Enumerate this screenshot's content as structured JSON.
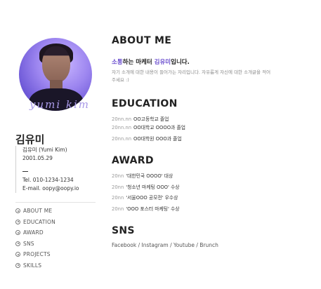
{
  "profile": {
    "signature": "yumi kim",
    "name": "김유미",
    "info": [
      "김유미 (Yumi Kim)",
      "2001.05.29"
    ],
    "contact": [
      "Tel. 010-1234-1234",
      "E-mail. oopy@oopy.io"
    ]
  },
  "nav": [
    "ABOUT ME",
    "EDUCATION",
    "AWARD",
    "SNS",
    "PROJECTS",
    "SKILLS"
  ],
  "about": {
    "title": "ABOUT ME",
    "headline_accent1": "소통",
    "headline_mid": "하는 마케터 ",
    "headline_accent2": "김유미",
    "headline_end": "입니다.",
    "text_line1": "자기 소개에 대한 내용이 들어가는 자리입니다. 자유롭게 자신에 대한 소개글을 적어",
    "text_line2": "주세요 :)"
  },
  "education": {
    "title": "EDUCATION",
    "items": [
      {
        "year": "20nn.nn",
        "text": "OO고등학교 졸업"
      },
      {
        "year": "20nn.nn",
        "text": "OO대학교 OOOO과 졸업"
      },
      {
        "year": "20nn.nn",
        "text": "OO대학원 OOO과 졸업"
      }
    ]
  },
  "award": {
    "title": "AWARD",
    "items": [
      {
        "year": "20nn",
        "text": "'대한민국 OOOO' 대상"
      },
      {
        "year": "20nn",
        "text": "'청소년 마케팅 OOO' 수상"
      },
      {
        "year": "20nn",
        "text": "'서울OOO 공모전' 우수상"
      },
      {
        "year": "20nn",
        "text": "'OOO 포스터 마케팅' 수상"
      }
    ]
  },
  "sns": {
    "title": "SNS",
    "links": [
      "Facebook",
      "Instagram",
      "Youtube",
      "Brunch"
    ],
    "separator": " / "
  },
  "colors": {
    "accent": "#6b4fcf",
    "avatar": "#9d86f0"
  }
}
